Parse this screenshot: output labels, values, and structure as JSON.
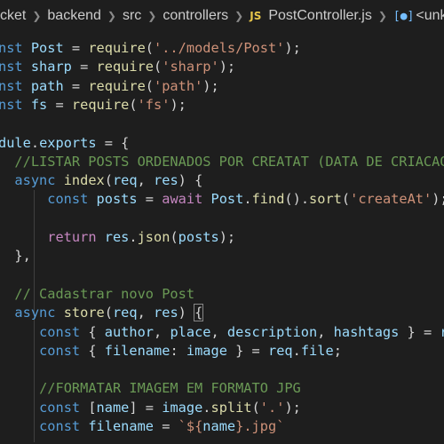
{
  "breadcrumb": {
    "items": [
      "cket",
      "backend",
      "src",
      "controllers",
      "PostController.js",
      "<unkno"
    ],
    "js_badge": "JS"
  },
  "editor": {
    "language": "javascript",
    "lines": [
      [
        [
          "kw",
          "nst "
        ],
        [
          "var",
          "Post"
        ],
        [
          "op",
          " = "
        ],
        [
          "fn",
          "require"
        ],
        [
          "pn",
          "("
        ],
        [
          "str",
          "'../models/Post'"
        ],
        [
          "pn",
          ");"
        ]
      ],
      [
        [
          "kw",
          "nst "
        ],
        [
          "var",
          "sharp"
        ],
        [
          "op",
          " = "
        ],
        [
          "fn",
          "require"
        ],
        [
          "pn",
          "("
        ],
        [
          "str",
          "'sharp'"
        ],
        [
          "pn",
          ");"
        ]
      ],
      [
        [
          "kw",
          "nst "
        ],
        [
          "var",
          "path"
        ],
        [
          "op",
          " = "
        ],
        [
          "fn",
          "require"
        ],
        [
          "pn",
          "("
        ],
        [
          "str",
          "'path'"
        ],
        [
          "pn",
          ");"
        ]
      ],
      [
        [
          "kw",
          "nst "
        ],
        [
          "var",
          "fs"
        ],
        [
          "op",
          " = "
        ],
        [
          "fn",
          "require"
        ],
        [
          "pn",
          "("
        ],
        [
          "str",
          "'fs'"
        ],
        [
          "pn",
          ");"
        ]
      ],
      [],
      [
        [
          "var",
          "dule"
        ],
        [
          "pn",
          "."
        ],
        [
          "var",
          "exports"
        ],
        [
          "op",
          " = "
        ],
        [
          "pn",
          "{"
        ]
      ],
      [
        [
          "pn",
          "  "
        ],
        [
          "cmt",
          "//LISTAR POSTS ORDENADOS POR CREATAT (DATA DE CRIACAO)"
        ]
      ],
      [
        [
          "pn",
          "  "
        ],
        [
          "kw",
          "async "
        ],
        [
          "fn",
          "index"
        ],
        [
          "pn",
          "("
        ],
        [
          "var",
          "req"
        ],
        [
          "pn",
          ", "
        ],
        [
          "var",
          "res"
        ],
        [
          "pn",
          ") {"
        ]
      ],
      [
        [
          "pn",
          "      "
        ],
        [
          "kw",
          "const "
        ],
        [
          "var",
          "posts"
        ],
        [
          "op",
          " = "
        ],
        [
          "ctl",
          "await "
        ],
        [
          "var",
          "Post"
        ],
        [
          "pn",
          "."
        ],
        [
          "fn",
          "find"
        ],
        [
          "pn",
          "()."
        ],
        [
          "fn",
          "sort"
        ],
        [
          "pn",
          "("
        ],
        [
          "str",
          "'createAt'"
        ],
        [
          "pn",
          ");"
        ]
      ],
      [],
      [
        [
          "pn",
          "      "
        ],
        [
          "ctl",
          "return "
        ],
        [
          "var",
          "res"
        ],
        [
          "pn",
          "."
        ],
        [
          "fn",
          "json"
        ],
        [
          "pn",
          "("
        ],
        [
          "var",
          "posts"
        ],
        [
          "pn",
          ");"
        ]
      ],
      [
        [
          "pn",
          "  },"
        ]
      ],
      [],
      [
        [
          "pn",
          "  "
        ],
        [
          "cmt",
          "// Cadastrar novo Post"
        ]
      ],
      [
        [
          "pn",
          "  "
        ],
        [
          "kw",
          "async "
        ],
        [
          "fn",
          "store"
        ],
        [
          "pn",
          "("
        ],
        [
          "var",
          "req"
        ],
        [
          "pn",
          ", "
        ],
        [
          "var",
          "res"
        ],
        [
          "pn",
          ") "
        ],
        [
          "bm",
          "{"
        ]
      ],
      [
        [
          "pn",
          "     "
        ],
        [
          "kw",
          "const "
        ],
        [
          "pn",
          "{ "
        ],
        [
          "var",
          "author"
        ],
        [
          "pn",
          ", "
        ],
        [
          "var",
          "place"
        ],
        [
          "pn",
          ", "
        ],
        [
          "var",
          "description"
        ],
        [
          "pn",
          ", "
        ],
        [
          "var",
          "hashtags"
        ],
        [
          "pn",
          " } = "
        ],
        [
          "var",
          "req"
        ]
      ],
      [
        [
          "pn",
          "     "
        ],
        [
          "kw",
          "const "
        ],
        [
          "pn",
          "{ "
        ],
        [
          "var",
          "filename"
        ],
        [
          "pn",
          ": "
        ],
        [
          "var",
          "image"
        ],
        [
          "pn",
          " } = "
        ],
        [
          "var",
          "req"
        ],
        [
          "pn",
          "."
        ],
        [
          "var",
          "file"
        ],
        [
          "pn",
          ";"
        ]
      ],
      [],
      [
        [
          "pn",
          "     "
        ],
        [
          "cmt",
          "//FORMATAR IMAGEM EM FORMATO JPG"
        ]
      ],
      [
        [
          "pn",
          "     "
        ],
        [
          "kw",
          "const "
        ],
        [
          "pn",
          "["
        ],
        [
          "var",
          "name"
        ],
        [
          "pn",
          "] = "
        ],
        [
          "var",
          "image"
        ],
        [
          "pn",
          "."
        ],
        [
          "fn",
          "split"
        ],
        [
          "pn",
          "("
        ],
        [
          "str",
          "'.'"
        ],
        [
          "pn",
          ");"
        ]
      ],
      [
        [
          "pn",
          "     "
        ],
        [
          "kw",
          "const "
        ],
        [
          "var",
          "filename"
        ],
        [
          "op",
          " = "
        ],
        [
          "str",
          "`${"
        ],
        [
          "var",
          "name"
        ],
        [
          "str",
          "}.jpg`"
        ]
      ]
    ]
  }
}
